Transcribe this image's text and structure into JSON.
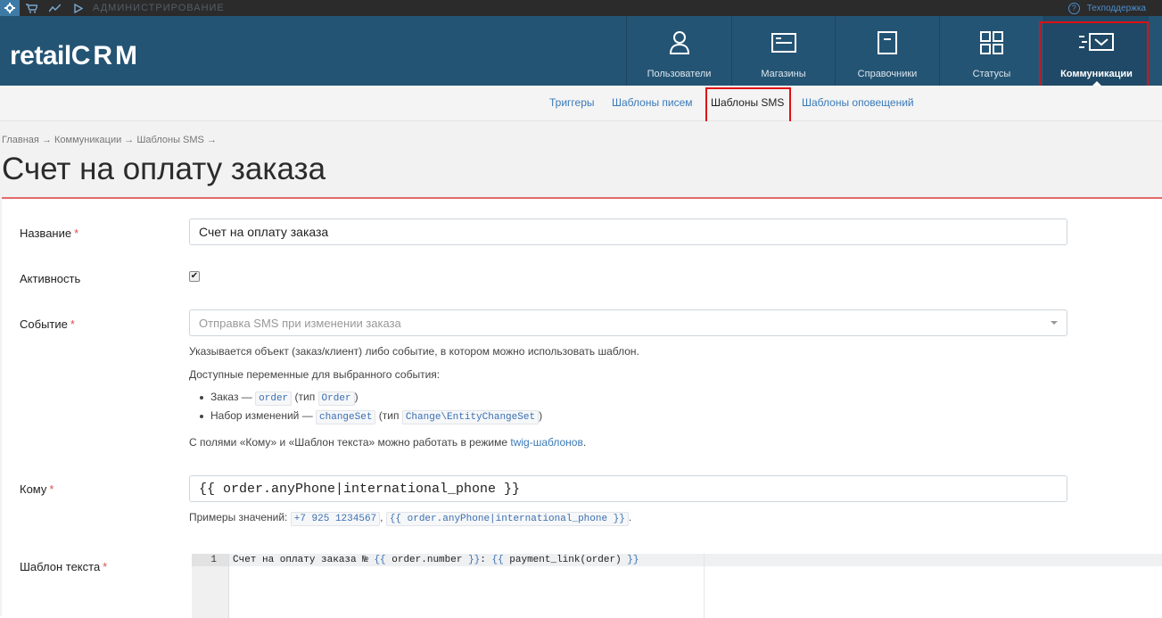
{
  "topbar": {
    "admin_label": "АДМИНИСТРИРОВАНИЕ",
    "support_label": "Техподдержка"
  },
  "logo": {
    "retail": "retail",
    "crm": "CRM"
  },
  "nav": [
    {
      "label": "Пользователи",
      "icon": "user-icon"
    },
    {
      "label": "Магазины",
      "icon": "store-icon"
    },
    {
      "label": "Справочники",
      "icon": "book-icon"
    },
    {
      "label": "Статусы",
      "icon": "statuses-icon"
    },
    {
      "label": "Коммуникации",
      "icon": "communications-icon",
      "active": true
    }
  ],
  "subnav": [
    {
      "label": "Триггеры"
    },
    {
      "label": "Шаблоны писем"
    },
    {
      "label": "Шаблоны SMS",
      "current": true
    },
    {
      "label": "Шаблоны оповещений"
    }
  ],
  "breadcrumb": "Главная → Коммуникации → Шаблоны SMS →",
  "page_title": "Счет на оплату заказа",
  "form": {
    "name_label": "Название",
    "name_value": "Счет на оплату заказа",
    "active_label": "Активность",
    "active_checked": true,
    "event_label": "Событие",
    "event_value": "Отправка SMS при изменении заказа",
    "event_help1": "Указывается объект (заказ/клиент) либо событие, в котором можно использовать шаблон.",
    "event_help2": "Доступные переменные для выбранного события:",
    "vars": [
      {
        "prefix": "Заказ — ",
        "var": "order",
        "mid": " (тип ",
        "type": "Order",
        "suffix": ")"
      },
      {
        "prefix": "Набор изменений — ",
        "var": "changeSet",
        "mid": " (тип ",
        "type": "Change\\EntityChangeSet",
        "suffix": ")"
      }
    ],
    "twig_help_prefix": "С полями «Кому» и «Шаблон текста» можно работать в режиме ",
    "twig_help_link": "twig-шаблонов",
    "twig_help_suffix": ".",
    "to_label": "Кому",
    "to_value": "{{ order.anyPhone|international_phone }}",
    "to_examples_prefix": "Примеры значений: ",
    "to_example1": "+7 925 1234567",
    "to_example_sep": ", ",
    "to_example2": "{{ order.anyPhone|international_phone }}",
    "to_examples_suffix": ".",
    "template_label": "Шаблон текста",
    "template_line_number": "1",
    "template_text_1": "Счет на оплату заказа № ",
    "template_var_1": "{{",
    "template_text_2": " order.number ",
    "template_var_2": "}}",
    "template_text_3": ": ",
    "template_var_3": "{{",
    "template_text_4": " payment_link(order) ",
    "template_var_4": "}}"
  },
  "colors": {
    "header_bg": "#245474",
    "highlight": "#e01010",
    "link": "#3a7ab8",
    "required": "#d9534f"
  }
}
